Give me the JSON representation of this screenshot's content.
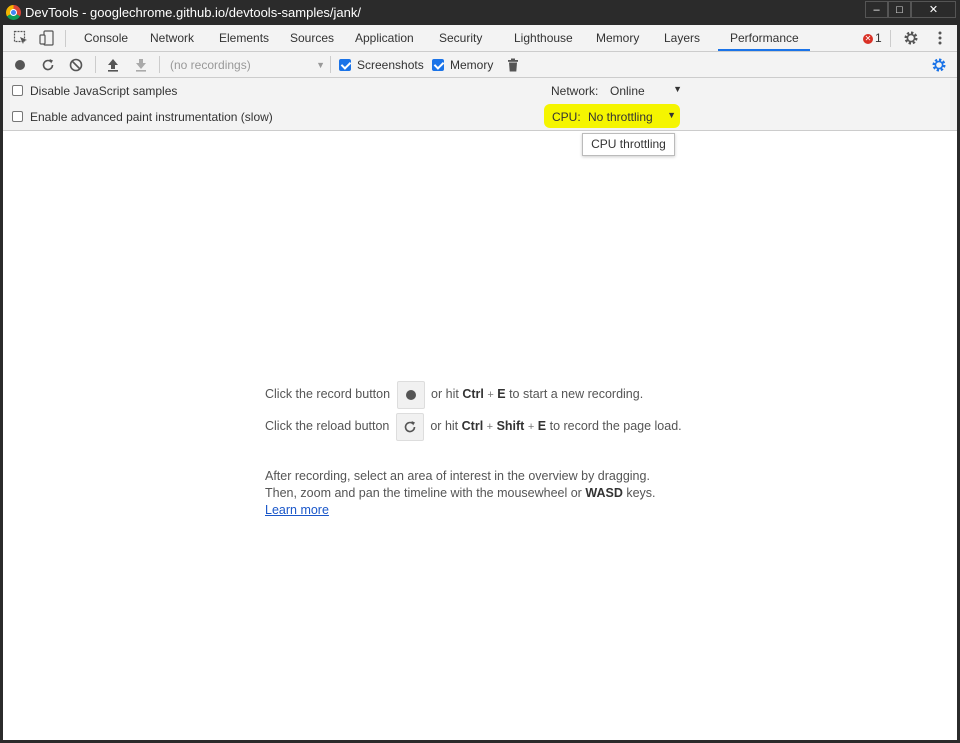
{
  "window": {
    "title": "DevTools - googlechrome.github.io/devtools-samples/jank/",
    "minimize": "–",
    "maximize": "□",
    "close": "✕"
  },
  "tabs": [
    "Console",
    "Network",
    "Elements",
    "Sources",
    "Application",
    "Security",
    "Lighthouse",
    "Memory",
    "Layers",
    "Performance"
  ],
  "active_tab": "Performance",
  "errors": {
    "count": "1"
  },
  "toolbar": {
    "recordings_placeholder": "(no recordings)",
    "screenshots_label": "Screenshots",
    "memory_label": "Memory",
    "screenshots_checked": true,
    "memory_checked": true
  },
  "settings": {
    "disable_js_samples": "Disable JavaScript samples",
    "advanced_paint": "Enable advanced paint instrumentation (slow)",
    "network_label": "Network:",
    "network_value": "Online",
    "cpu_label": "CPU:",
    "cpu_value": "No throttling",
    "tooltip": "CPU throttling"
  },
  "landing": {
    "record_pre": "Click the record button",
    "record_mid": "or hit",
    "record_key1": "Ctrl",
    "record_plus": "+",
    "record_key2": "E",
    "record_post": "to start a new recording.",
    "reload_pre": "Click the reload button",
    "reload_mid": "or hit",
    "reload_key1": "Ctrl",
    "reload_plus1": "+",
    "reload_key2": "Shift",
    "reload_plus2": "+",
    "reload_key3": "E",
    "reload_post": "to record the page load.",
    "after_line1": "After recording, select an area of interest in the overview by dragging.",
    "after_line2_pre": "Then, zoom and pan the timeline with the mousewheel or",
    "after_line2_key": "WASD",
    "after_line2_post": "keys.",
    "learn_more": "Learn more"
  },
  "colors": {
    "accent": "#1a73e8",
    "highlight": "#f5f500",
    "error": "#d93025"
  },
  "icons": [
    "chrome-logo-icon",
    "inspect-element-icon",
    "device-toolbar-icon",
    "error-icon",
    "settings-gear-icon",
    "more-vertical-icon",
    "record-icon",
    "reload-icon",
    "clear-icon",
    "upload-icon",
    "download-icon",
    "trash-icon",
    "capture-settings-icon"
  ]
}
